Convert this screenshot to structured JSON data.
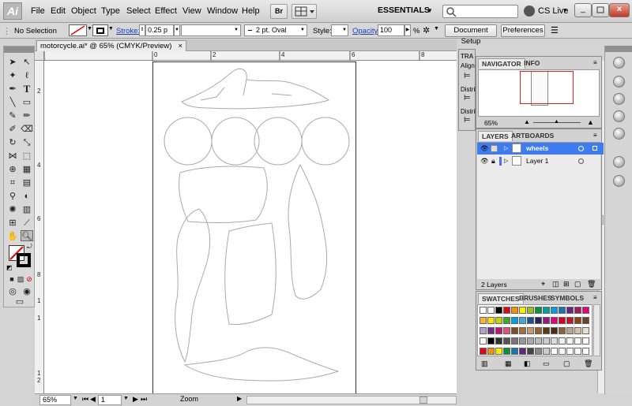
{
  "app": {
    "logo": "Ai",
    "workspace": "ESSENTIALS",
    "cs_live": "CS Live"
  },
  "menu": [
    "File",
    "Edit",
    "Object",
    "Type",
    "Select",
    "Effect",
    "View",
    "Window",
    "Help"
  ],
  "menu_button": "Br",
  "control": {
    "selection": "No Selection",
    "stroke_label": "Stroke:",
    "stroke_value": "0.25 p",
    "brush_value": "2 pt. Oval",
    "style_label": "Style:",
    "opacity_label": "Opacity:",
    "opacity_value": "100",
    "opacity_unit": "%",
    "document_setup": "Document Setup",
    "preferences": "Preferences"
  },
  "document": {
    "tab": "motorcycle.ai* @ 65% (CMYK/Preview)"
  },
  "ruler": {
    "h": [
      "0",
      "2",
      "4",
      "6",
      "8"
    ],
    "v": [
      "2",
      "4",
      "6",
      "8",
      "1",
      "1",
      "1",
      "2"
    ]
  },
  "status": {
    "zoom": "65%",
    "page": "1",
    "mode": "Zoom"
  },
  "panels": {
    "transform_tab": "TRA",
    "align_label": "Align",
    "distribute1": "Distrib",
    "distribute2": "Distrib",
    "navigator_tab": "NAVIGATOR",
    "info_tab": "INFO",
    "navigator_zoom": "65%",
    "layers_tab": "LAYERS",
    "artboards_tab": "ARTBOARDS",
    "layers": [
      {
        "name": "wheels",
        "color": "#3f7cf0",
        "selected": true
      },
      {
        "name": "Layer 1",
        "color": "#4a6cf7",
        "selected": false
      }
    ],
    "layers_count": "2 Layers",
    "swatches_tab": "SWATCHES",
    "brushes_tab": "BRUSHES",
    "symbols_tab": "SYMBOLS"
  },
  "colors": {
    "accent": "#3f7cf0",
    "nav_box": "#e02020"
  }
}
